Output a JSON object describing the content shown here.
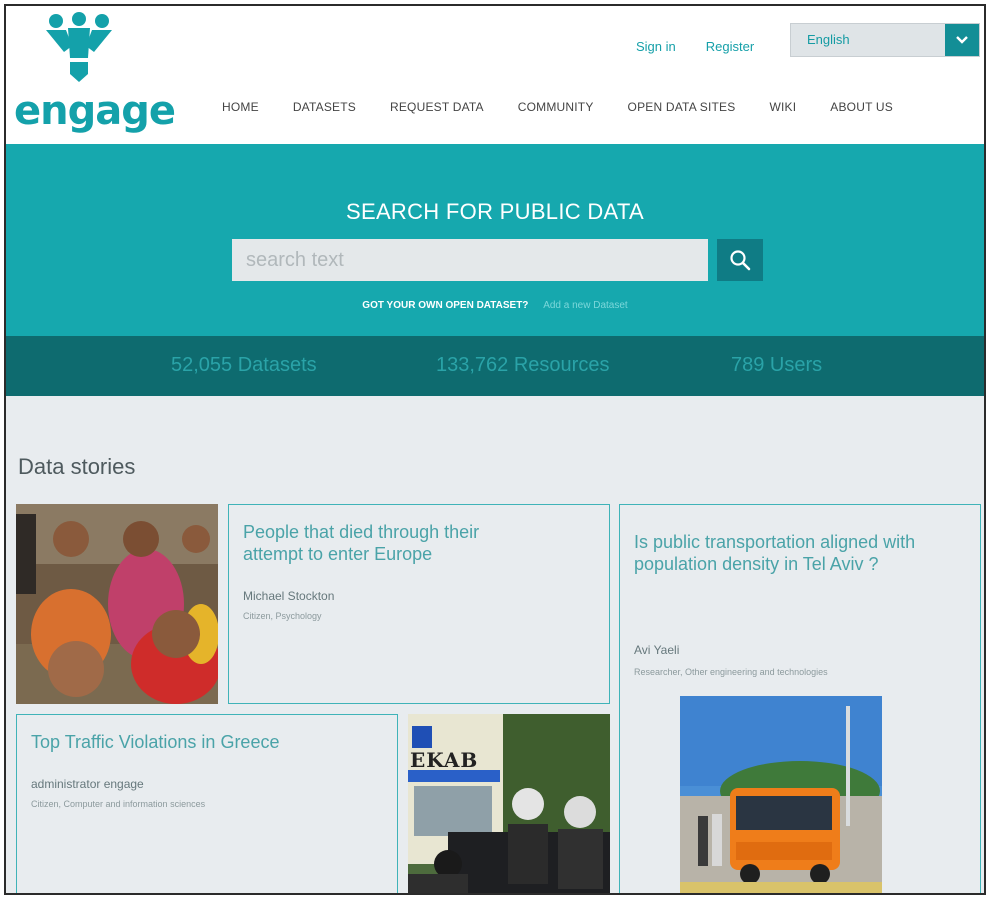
{
  "brand": {
    "logo_text": "engage"
  },
  "header": {
    "sign_in": "Sign in",
    "register": "Register",
    "language": "English"
  },
  "nav": {
    "items": [
      "HOME",
      "DATASETS",
      "REQUEST DATA",
      "COMMUNITY",
      "OPEN DATA SITES",
      "WIKI",
      "ABOUT US"
    ]
  },
  "hero": {
    "title": "SEARCH FOR PUBLIC DATA",
    "search_placeholder": "search text",
    "own_dataset_question": "GOT YOUR OWN OPEN DATASET?",
    "add_dataset_link": "Add a new Dataset"
  },
  "stats": {
    "datasets": "52,055 Datasets",
    "resources": "133,762 Resources",
    "users": "789 Users"
  },
  "stories": {
    "section_title": "Data stories",
    "cards": [
      {
        "title": "People that died through their attempt to enter Europe",
        "author": "Michael Stockton",
        "role": "Citizen, Psychology"
      },
      {
        "title": "Is public transportation aligned with population density in Tel Aviv ?",
        "author": "Avi Yaeli",
        "role": "Researcher, Other engineering and technologies"
      },
      {
        "title": "Top Traffic Violations in Greece",
        "author": "administrator engage",
        "role": "Citizen, Computer and information sciences"
      }
    ],
    "photo_signage": "EKAB"
  },
  "colors": {
    "brand_teal": "#14a1aa",
    "hero_bg": "#16a8ae",
    "stats_bg": "#0e6b6f",
    "search_button": "#0f7c85",
    "page_bg": "#e8ecef"
  },
  "icons": [
    "logo-people-icon",
    "chevron-down-icon",
    "search-icon"
  ]
}
